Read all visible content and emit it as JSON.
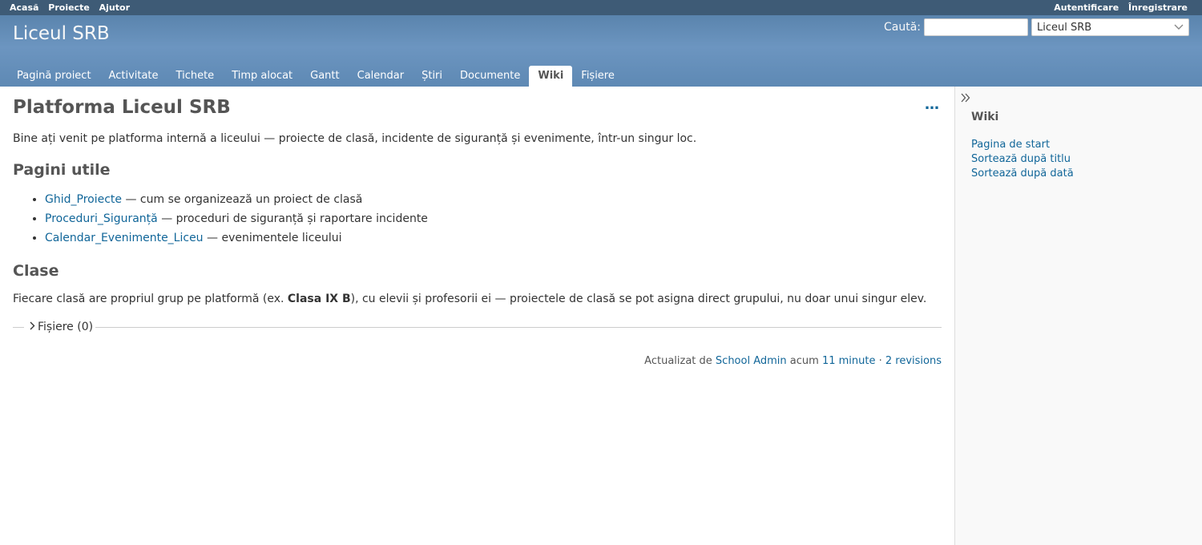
{
  "top_menu": {
    "left": [
      "Acasă",
      "Proiecte",
      "Ajutor"
    ],
    "login": "Autentificare",
    "register": "Înregistrare"
  },
  "header": {
    "title": "Liceul SRB",
    "search_label": "Caută:",
    "search_value": "",
    "project_select": "Liceul SRB"
  },
  "tabs": [
    "Pagină proiect",
    "Activitate",
    "Tichete",
    "Timp alocat",
    "Gantt",
    "Calendar",
    "Știri",
    "Documente",
    "Wiki",
    "Fișiere"
  ],
  "selected_tab": "Wiki",
  "content": {
    "title": "Platforma Liceul SRB",
    "more": "…",
    "intro": "Bine ați venit pe platforma internă a liceului — proiecte de clasă, incidente de siguranță și evenimente, într-un singur loc.",
    "useful_heading": "Pagini utile",
    "useful_links": [
      {
        "link": "Ghid_Proiecte",
        "desc": " — cum se organizează un proiect de clasă"
      },
      {
        "link": "Proceduri_Siguranță",
        "desc": " — proceduri de siguranță și raportare incidente"
      },
      {
        "link": "Calendar_Evenimente_Liceu",
        "desc": " — evenimentele liceului"
      }
    ],
    "classes_heading": "Clase",
    "classes_pre": "Fiecare clasă are propriul grup pe platformă (ex. ",
    "classes_bold": "Clasa IX B",
    "classes_post": "), cu elevii și profesorii ei — proiectele de clasă se pot asigna direct grupului, nu doar unui singur elev.",
    "attachments_label": "Fișiere (0)",
    "updated_prefix": "Actualizat de ",
    "updated_author": "School Admin",
    "updated_mid": " acum ",
    "updated_time": "11 minute",
    "updated_sep": " · ",
    "revisions": "2 revisions"
  },
  "sidebar": {
    "heading": "Wiki",
    "links": [
      "Pagina de start",
      "Sortează după titlu",
      "Sortează după dată"
    ]
  }
}
